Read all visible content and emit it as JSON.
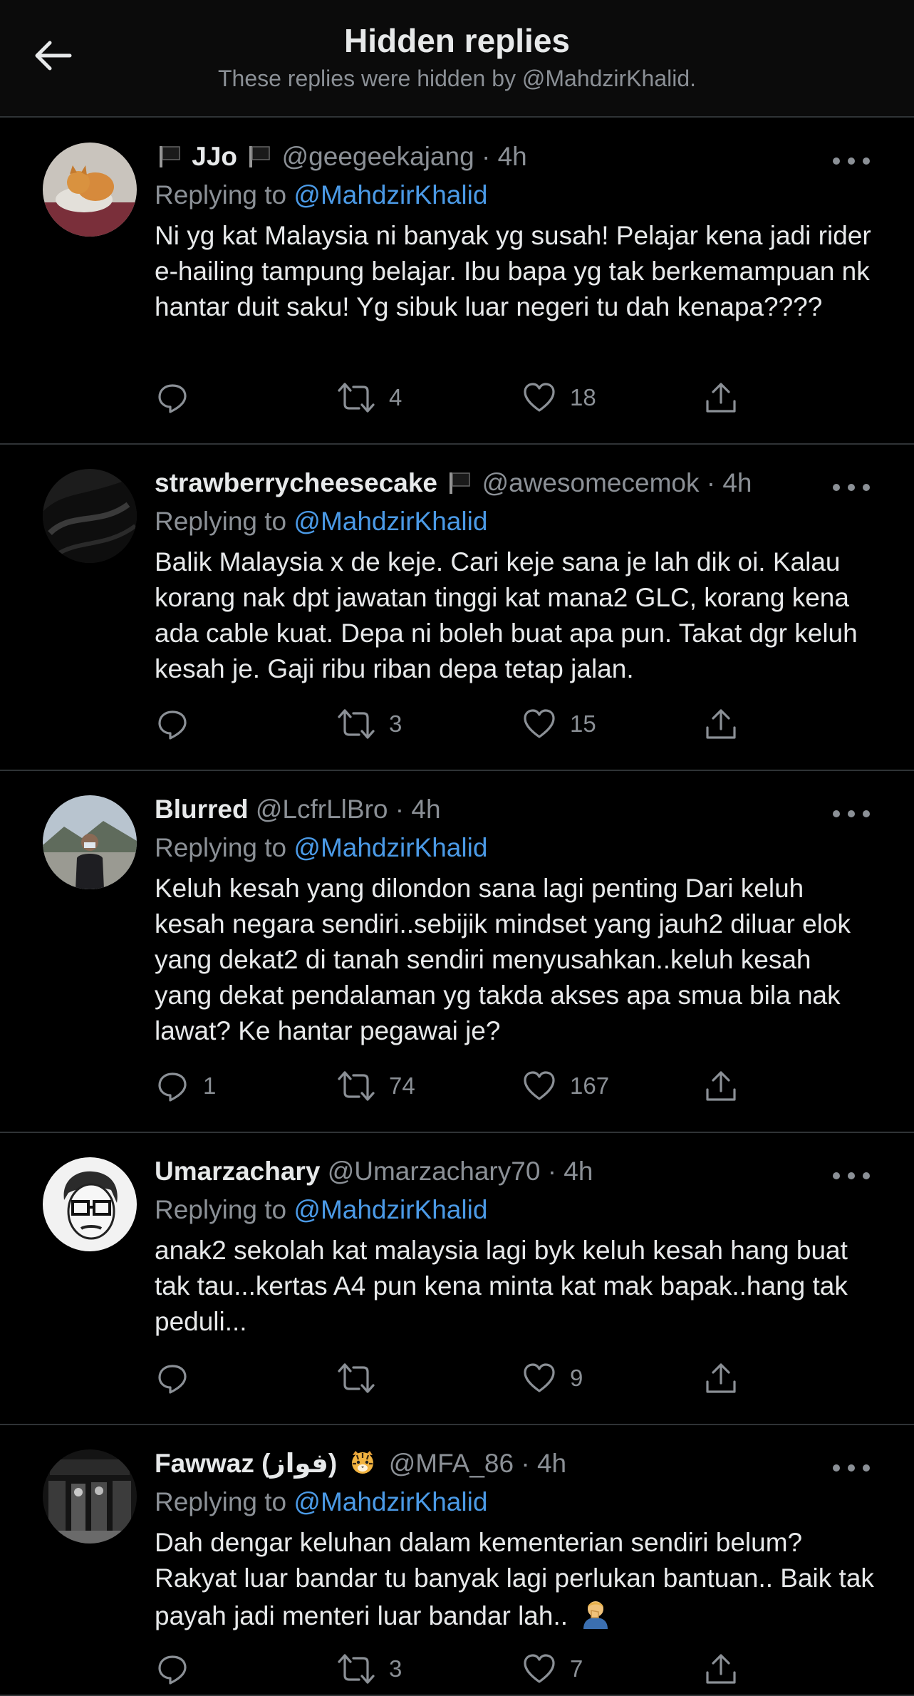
{
  "header": {
    "title": "Hidden replies",
    "subtitle": "These replies were hidden by @MahdzirKhalid."
  },
  "replying_label": "Replying to",
  "tweets": [
    {
      "name": "JJo",
      "handle": "@geegeekajang",
      "time": "4h",
      "mention": "@MahdzirKhalid",
      "text": "Ni yg kat Malaysia ni banyak yg susah! Pelajar kena jadi rider e-hailing tampung belajar. Ibu bapa yg tak berkemampuan nk hantar duit saku! Yg sibuk luar negeri tu dah kenapa????",
      "replies": "",
      "retweets": "4",
      "likes": "18",
      "avatar_icon": "cat-photo"
    },
    {
      "name": "strawberrycheesecake",
      "handle": "@awesomecemok",
      "time": "4h",
      "mention": "@MahdzirKhalid",
      "text": "Balik Malaysia x de keje. Cari keje sana je lah dik oi. Kalau korang nak dpt jawatan tinggi kat mana2 GLC, korang kena ada cable kuat. Depa ni boleh buat apa pun. Takat dgr keluh kesah je. Gaji ribu riban depa tetap jalan.",
      "replies": "",
      "retweets": "3",
      "likes": "15",
      "avatar_icon": "dark-fabric-photo"
    },
    {
      "name": "Blurred",
      "handle": "@LcfrLlBro",
      "time": "4h",
      "mention": "@MahdzirKhalid",
      "text": "Keluh kesah yang dilondon sana lagi penting Dari keluh kesah negara sendiri..sebijik mindset yang jauh2 diluar elok yang dekat2 di tanah sendiri menyusahkan..keluh kesah yang dekat pendalaman yg takda akses apa smua bila nak lawat? Ke hantar pegawai je?",
      "replies": "1",
      "retweets": "74",
      "likes": "167",
      "avatar_icon": "person-outdoor-photo"
    },
    {
      "name": "Umarzachary",
      "handle": "@Umarzachary70",
      "time": "4h",
      "mention": "@MahdzirKhalid",
      "text": "anak2 sekolah kat malaysia lagi byk keluh kesah hang buat tak tau...kertas A4 pun kena minta kat mak bapak..hang tak peduli...",
      "replies": "",
      "retweets": "",
      "likes": "9",
      "avatar_icon": "cartoon-face-glasses"
    },
    {
      "name": "Fawwaz (فواز)",
      "handle": "@MFA_86",
      "time": "4h",
      "mention": "@MahdzirKhalid",
      "text": "Dah dengar keluhan dalam kementerian sendiri belum? Rakyat luar bandar tu banyak lagi perlukan bantuan.. Baik tak payah jadi menteri luar bandar lah..",
      "replies": "",
      "retweets": "3",
      "likes": "7",
      "avatar_icon": "shop-interior-photo"
    }
  ],
  "colors": {
    "background": "#000000",
    "header_bg": "#0b0b0b",
    "text": "#e7e9ea",
    "muted": "#8b9096",
    "mention": "#4b9ae6",
    "divider": "#2f3336"
  }
}
